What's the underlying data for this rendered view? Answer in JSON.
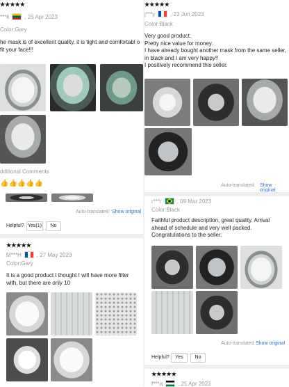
{
  "reviews": {
    "left_top": {
      "stars": "★★★★★",
      "user": "***k",
      "date": ", 25 Apr 2023",
      "color": "Color:Gary",
      "text": "he mask is of excellent quality, it is tight and comfortabl o fit your face!!!",
      "additional": "dditional Comments",
      "emoji": "👍👍👍👍👍",
      "auto_translated": "Auto-translated",
      "show_original": "Show original",
      "helpful_label": "Helpful?",
      "yes_label": "Yes(1)",
      "no_label": "No"
    },
    "left_bottom": {
      "stars": "★★★★★",
      "user": "M***H",
      "date": ", 27 May 2023",
      "color": "Color:Gary",
      "text": "It is a good product I thought I will have more filter with, but there are only 10"
    },
    "right_top": {
      "stars": "★★★★★",
      "user": "j***y",
      "date": ", 23 Jun 2023",
      "color": "Color:Black",
      "text": "Very good product.\nPretty nice value for money.\nI have already bought another mask from the same seller, in black and I am very happy!!\nI positively recommend this seller.",
      "auto_translated": "Auto-translated",
      "show_original": "Show original"
    },
    "right_middle": {
      "user": "r***r",
      "date": ", 09 Mar 2023",
      "color": "Color:Black",
      "text": "Faithful product description, great quality. Arrival ahead of schedule and very well packed. Congratulations to the seller.",
      "auto_translated": "Auto-translated",
      "show_original": "Show original",
      "helpful_label": "Helpful?",
      "yes_label": "Yes",
      "no_label": "No"
    },
    "right_bottom": {
      "stars": "★★★★★",
      "user": "f***a",
      "date": ", 25 Apr 2023"
    }
  },
  "colors": {
    "stars": "#111111",
    "link": "#2f6fd6",
    "muted": "#999999"
  }
}
